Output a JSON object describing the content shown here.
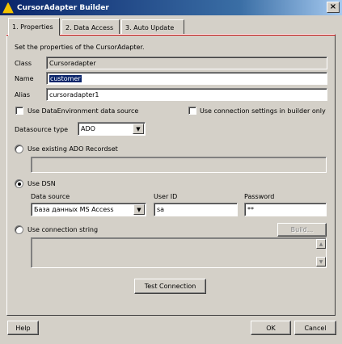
{
  "window": {
    "title": "CursorAdapter Builder",
    "close_label": "×"
  },
  "tabs": [
    {
      "label": "1. Properties",
      "active": true
    },
    {
      "label": "2. Data Access",
      "active": false
    },
    {
      "label": "3. Auto Update",
      "active": false
    }
  ],
  "properties": {
    "instruction": "Set the properties of the CursorAdapter.",
    "class_label": "Class",
    "class_value": "Cursoradapter",
    "name_label": "Name",
    "name_value": "customer",
    "alias_label": "Alias",
    "alias_value": "cursoradapter1",
    "use_dataenv_label": "Use DataEnvironment data source",
    "use_dataenv_checked": false,
    "use_conn_settings_label": "Use connection settings in builder only",
    "use_conn_settings_checked": false,
    "datasource_type_label": "Datasource type",
    "datasource_type_value": "ADO"
  },
  "ado_recordset": {
    "label": "Use existing ADO Recordset",
    "selected": false
  },
  "dsn": {
    "label": "Use DSN",
    "selected": true,
    "data_source_label": "Data source",
    "data_source_value": "База данных MS Access",
    "user_id_label": "User ID",
    "user_id_value": "sa",
    "password_label": "Password",
    "password_value": "**"
  },
  "connection_string": {
    "label": "Use connection string",
    "selected": false,
    "build_label": "Build..."
  },
  "test_connection_label": "Test Connection",
  "footer": {
    "help_label": "Help",
    "ok_label": "OK",
    "cancel_label": "Cancel"
  }
}
